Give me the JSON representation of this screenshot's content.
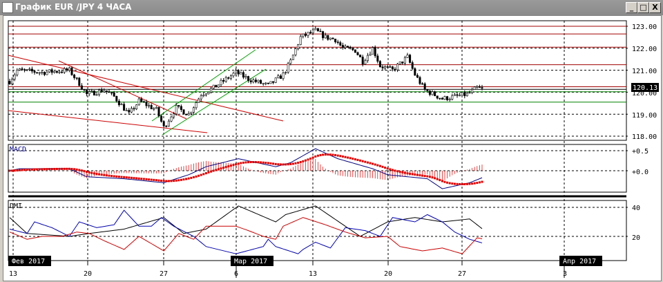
{
  "window": {
    "title": "График EUR /JPY  4 ЧАСА",
    "min": "_",
    "max": "□",
    "close": "X"
  },
  "chart_data": [
    {
      "type": "candlestick",
      "title": "EUR/JPY 4H",
      "ylim": [
        118,
        123
      ],
      "yticks": [
        "123.00",
        "122.00",
        "121.00",
        "120.00",
        "119.00",
        "118.00"
      ],
      "current_price": "120.13",
      "close_anchors": [
        [
          0,
          120.5
        ],
        [
          3,
          121.0
        ],
        [
          13,
          120.9
        ],
        [
          24,
          121.0
        ],
        [
          28,
          120.4
        ],
        [
          31,
          119.9
        ],
        [
          38,
          120.1
        ],
        [
          42,
          119.8
        ],
        [
          48,
          119.0
        ],
        [
          52,
          119.6
        ],
        [
          59,
          119.2
        ],
        [
          62,
          118.4
        ],
        [
          67,
          119.3
        ],
        [
          72,
          119.0
        ],
        [
          77,
          119.9
        ],
        [
          82,
          120.2
        ],
        [
          91,
          120.9
        ],
        [
          96,
          120.6
        ],
        [
          104,
          120.3
        ],
        [
          110,
          120.8
        ],
        [
          113,
          121.4
        ],
        [
          117,
          122.5
        ],
        [
          123,
          122.8
        ],
        [
          127,
          122.5
        ],
        [
          131,
          122.4
        ],
        [
          134,
          122.0
        ],
        [
          139,
          121.9
        ],
        [
          142,
          121.4
        ],
        [
          146,
          122.0
        ],
        [
          149,
          121.2
        ],
        [
          154,
          121.0
        ],
        [
          160,
          121.6
        ],
        [
          163,
          120.8
        ],
        [
          167,
          120.1
        ],
        [
          174,
          119.7
        ],
        [
          179,
          119.8
        ],
        [
          184,
          119.9
        ],
        [
          188,
          120.2
        ],
        [
          190,
          120.13
        ]
      ],
      "red_levels": [
        123.0,
        122.65,
        122.05,
        121.25,
        120.25
      ],
      "green_levels": [
        120.02,
        119.55
      ]
    },
    {
      "type": "line",
      "title": "MACD",
      "ylim": [
        -0.5,
        0.7
      ],
      "yticks": [
        "+0.5",
        "+0.0"
      ],
      "macd_anchors": [
        [
          0,
          0.0
        ],
        [
          4,
          0.05
        ],
        [
          24,
          0.05
        ],
        [
          31,
          -0.15
        ],
        [
          46,
          -0.2
        ],
        [
          62,
          -0.3
        ],
        [
          72,
          -0.1
        ],
        [
          79,
          0.1
        ],
        [
          92,
          0.3
        ],
        [
          107,
          0.1
        ],
        [
          113,
          0.2
        ],
        [
          123,
          0.55
        ],
        [
          132,
          0.3
        ],
        [
          146,
          0.05
        ],
        [
          152,
          -0.1
        ],
        [
          168,
          -0.2
        ],
        [
          174,
          -0.45
        ],
        [
          185,
          -0.3
        ],
        [
          191,
          -0.15
        ]
      ]
    },
    {
      "type": "line",
      "title": "DMI",
      "ylim": [
        0,
        44
      ],
      "yticks": [
        "40",
        "20"
      ],
      "adx_anchors": [
        [
          0,
          33
        ],
        [
          7,
          22
        ],
        [
          24,
          20
        ],
        [
          32,
          22
        ],
        [
          46,
          25
        ],
        [
          62,
          33
        ],
        [
          70,
          22
        ],
        [
          79,
          25
        ],
        [
          92,
          41
        ],
        [
          107,
          30
        ],
        [
          111,
          35
        ],
        [
          123,
          41
        ],
        [
          129,
          34
        ],
        [
          141,
          20
        ],
        [
          152,
          30
        ],
        [
          163,
          33
        ],
        [
          174,
          30
        ],
        [
          185,
          32
        ],
        [
          191,
          24
        ]
      ],
      "pdi_anchors": [
        [
          0,
          25
        ],
        [
          7,
          22
        ],
        [
          10,
          30
        ],
        [
          17,
          26
        ],
        [
          24,
          20
        ],
        [
          28,
          30
        ],
        [
          35,
          26
        ],
        [
          42,
          28
        ],
        [
          46,
          38
        ],
        [
          52,
          27
        ],
        [
          57,
          27
        ],
        [
          61,
          33
        ],
        [
          66,
          27
        ],
        [
          74,
          20
        ],
        [
          79,
          13
        ],
        [
          91,
          8
        ],
        [
          102,
          13
        ],
        [
          104,
          18
        ],
        [
          107,
          13
        ],
        [
          116,
          8
        ],
        [
          118,
          11
        ],
        [
          123,
          16
        ],
        [
          129,
          12
        ],
        [
          135,
          26
        ],
        [
          143,
          24
        ],
        [
          149,
          20
        ],
        [
          154,
          33
        ],
        [
          163,
          30
        ],
        [
          168,
          35
        ],
        [
          174,
          30
        ],
        [
          179,
          23
        ],
        [
          185,
          18
        ],
        [
          191,
          15
        ]
      ],
      "mdi_anchors": [
        [
          0,
          23
        ],
        [
          7,
          18
        ],
        [
          13,
          20
        ],
        [
          21,
          20
        ],
        [
          27,
          23
        ],
        [
          32,
          22
        ],
        [
          38,
          17
        ],
        [
          46,
          11
        ],
        [
          52,
          20
        ],
        [
          62,
          10
        ],
        [
          68,
          22
        ],
        [
          74,
          18
        ],
        [
          79,
          27
        ],
        [
          91,
          27
        ],
        [
          96,
          24
        ],
        [
          102,
          20
        ],
        [
          107,
          18
        ],
        [
          110,
          27
        ],
        [
          118,
          33
        ],
        [
          127,
          28
        ],
        [
          135,
          23
        ],
        [
          143,
          19
        ],
        [
          152,
          20
        ],
        [
          157,
          13
        ],
        [
          166,
          10
        ],
        [
          174,
          12
        ],
        [
          182,
          8
        ],
        [
          188,
          19
        ],
        [
          191,
          18
        ]
      ]
    }
  ],
  "time_axis": {
    "day_labels": [
      "13",
      "20",
      "27",
      "6",
      "13",
      "20",
      "27",
      "3"
    ],
    "month_labels": [
      "Фев 2017",
      "Мар 2017",
      "Апр 2017"
    ]
  }
}
